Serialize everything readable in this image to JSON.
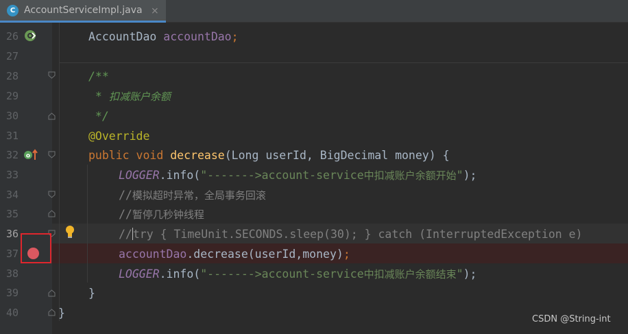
{
  "tab": {
    "icon_letter": "C",
    "title": "AccountServiceImpl.java",
    "close_glyph": "⨯"
  },
  "gutter": {
    "line_numbers": [
      "26",
      "27",
      "28",
      "29",
      "30",
      "31",
      "32",
      "33",
      "34",
      "35",
      "36",
      "37",
      "38",
      "39",
      "40"
    ],
    "icons": {
      "line26": "spring-autowired-icon",
      "line32": "override-method-icon",
      "line36": "intention-bulb-icon",
      "line37": "breakpoint-icon"
    }
  },
  "code": {
    "l26": {
      "type": "AccountDao",
      "field": "accountDao",
      "semi": ";"
    },
    "l28": {
      "text": "/**"
    },
    "l29": {
      "prefix": " * ",
      "text": "扣减账户余额"
    },
    "l30": {
      "text": " */"
    },
    "l31": {
      "text": "@Override"
    },
    "l32": {
      "kw1": "public",
      "kw2": "void",
      "method": "decrease",
      "params": "(Long userId, BigDecimal money) {"
    },
    "l33": {
      "logger": "LOGGER",
      "call": ".info(",
      "str_ascii": "\"------->account-service",
      "str_cjk": "中扣减账户余额开始",
      "str_end": "\"",
      "end": ");"
    },
    "l34": {
      "slashes": "//",
      "text": "模拟超时异常，全局事务回滚"
    },
    "l35": {
      "slashes": "//",
      "text": "暂停几秒钟线程"
    },
    "l36": {
      "slashes": "//",
      "text": "try { TimeUnit.SECONDS.sleep(30); } catch (InterruptedException e)"
    },
    "l37": {
      "field": "accountDao",
      "call": ".decrease(userId,money)",
      "semi": ";"
    },
    "l38": {
      "logger": "LOGGER",
      "call": ".info(",
      "str_ascii": "\"------->account-service",
      "str_cjk": "中扣减账户余额结束",
      "str_end": "\"",
      "end": ");"
    },
    "l39": {
      "text": "}"
    },
    "l40": {
      "text": "}"
    }
  },
  "watermark": "CSDN @String-int",
  "colors": {
    "editor_bg": "#2b2b2b",
    "gutter_bg": "#313335",
    "keyword": "#cc7832",
    "annotation": "#bbb529",
    "method": "#ffc66d",
    "field": "#9876aa",
    "string": "#6a8759",
    "comment": "#808080",
    "breakpoint": "#db5860",
    "highlight_box": "#e0262d"
  }
}
